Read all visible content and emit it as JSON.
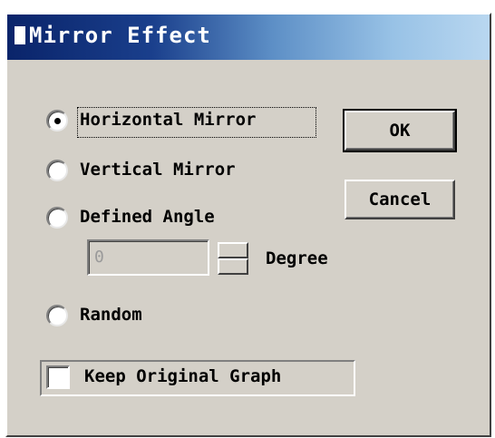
{
  "window": {
    "title": "Mirror Effect"
  },
  "options": {
    "horizontal_label": "Horizontal Mirror",
    "vertical_label": "Vertical Mirror",
    "defined_angle_label": "Defined Angle",
    "random_label": "Random",
    "selected": "Horizontal Mirror"
  },
  "angle": {
    "value": "0",
    "unit_label": "Degree"
  },
  "buttons": {
    "ok_label": "OK",
    "cancel_label": "Cancel"
  },
  "keep_original": {
    "label": "Keep Original Graph",
    "checked": false
  }
}
